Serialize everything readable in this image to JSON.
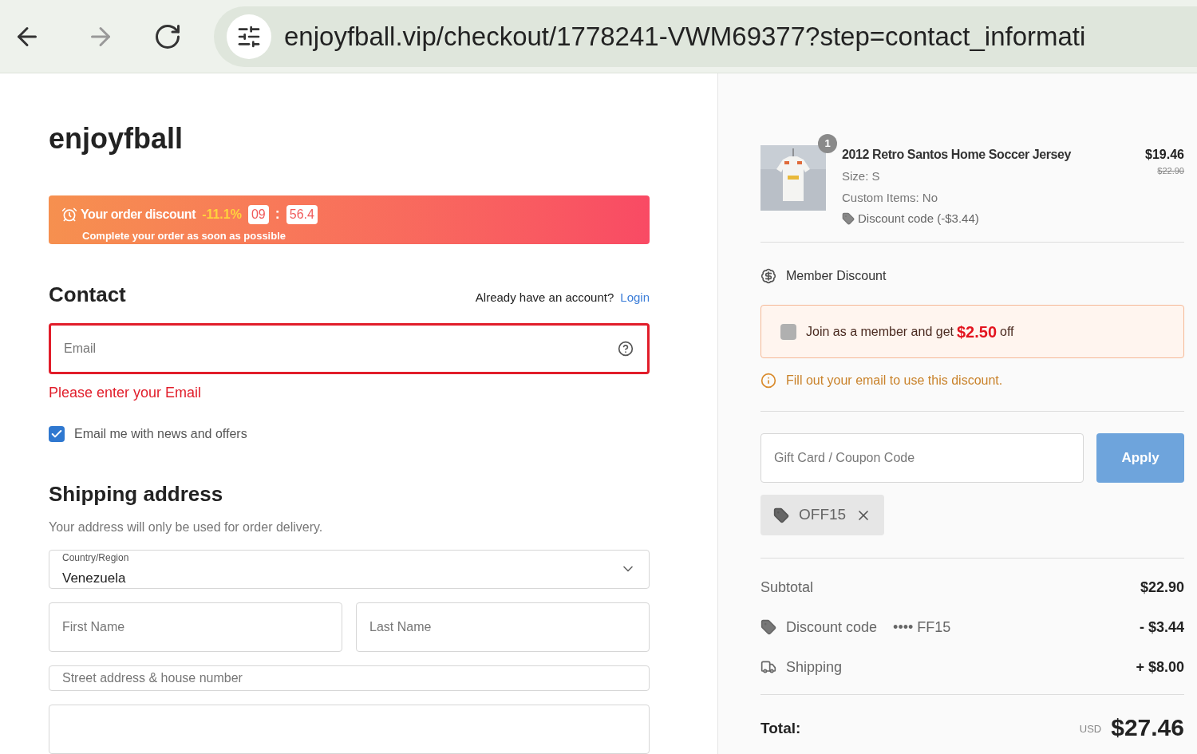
{
  "browser": {
    "url": "enjoyfball.vip/checkout/1778241-VWM69377?step=contact_informati"
  },
  "store": {
    "name": "enjoyfball"
  },
  "banner": {
    "title": "Your order discount",
    "discount": "-11.1%",
    "minutes": "09",
    "separator": ":",
    "seconds": "56.4",
    "subtitle": "Complete your order as soon as possible"
  },
  "contact": {
    "heading": "Contact",
    "account_prompt": "Already have an account?",
    "login_link": "Login",
    "email": {
      "placeholder": "Email",
      "invalid": true
    },
    "error": "Please enter your Email",
    "newsletter": {
      "label": "Email me with news and offers",
      "checked": true
    }
  },
  "shipping": {
    "heading": "Shipping address",
    "note": "Your address will only be used for order delivery.",
    "country": {
      "label": "Country/Region",
      "value": "Venezuela"
    },
    "first_name": {
      "placeholder": "First Name"
    },
    "last_name": {
      "placeholder": "Last Name"
    },
    "street": {
      "placeholder": "Street address & house number"
    }
  },
  "order": {
    "item": {
      "quantity": "1",
      "title": "2012 Retro Santos Home Soccer Jersey",
      "size": "Size: S",
      "custom": "Custom Items: No",
      "discount": "Discount code (-$3.44)",
      "price": "$19.46",
      "original_price": "$22.90"
    },
    "member": {
      "heading": "Member Discount",
      "offer_prefix": "Join as a member and get",
      "offer_amount": "$2.50",
      "offer_suffix": "off",
      "checked": false,
      "hint": "Fill out your email to use this discount."
    },
    "coupon": {
      "placeholder": "Gift Card / Coupon Code",
      "button": "Apply",
      "applied_code": "OFF15"
    },
    "summary": [
      {
        "kind": "plain",
        "label": "Subtotal",
        "value": "$22.90"
      },
      {
        "kind": "discount",
        "label": "Discount code",
        "code": "•••• FF15",
        "value": "- $3.44"
      },
      {
        "kind": "shipping",
        "label": "Shipping",
        "value": "+ $8.00"
      }
    ],
    "total": {
      "label": "Total:",
      "currency": "USD",
      "value": "$27.46"
    }
  }
}
